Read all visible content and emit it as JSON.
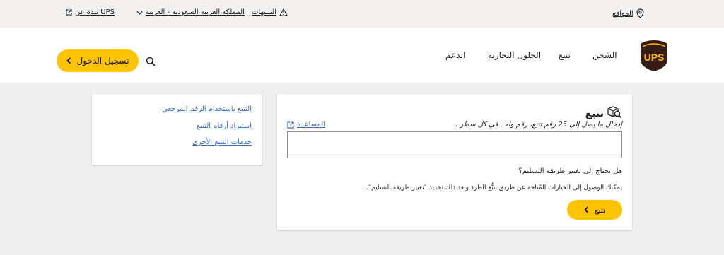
{
  "utility": {
    "about": "نبذة عن UPS",
    "country": "المملكة العربية السعودية - العربية",
    "alerts": "التنبيهات",
    "locations": "المواقع"
  },
  "nav": {
    "shipping": "الشحن",
    "track": "تتبع",
    "business": "الحلول التجارية",
    "support": "الدعم"
  },
  "login": {
    "label": "تسجيل الدخول"
  },
  "side_links": [
    "التتبع باستخدام الرقم المرجعي",
    "استيراد أرقام التتبع",
    "خدمات التتبع الأخرى"
  ],
  "track": {
    "title": "تتبع",
    "instructions": "إدخال ما يصل إلى 25 رقم تتبع، رقم واحد في كل سطر .",
    "help": "المساعدة",
    "input_value": "",
    "question": "هل تحتاج إلى تغيير طريقة التسليم؟",
    "info": "يمكنك الوصول إلى الخيارات المُتاحة عن طريق تتبُّع الطرد وبعد ذلك تحديد \"تغيير طريقة التسليم\".",
    "button": "تتبع"
  },
  "colors": {
    "accent": "#ffc400",
    "link": "#426da9",
    "brand_brown": "#351c15",
    "brand_gold": "#ffb500"
  },
  "icons": [
    "external-link-icon",
    "chevron-down-icon",
    "alert-triangle-icon",
    "location-pin-icon",
    "ups-logo",
    "search-icon",
    "chevron-left-icon",
    "track-package-icon"
  ]
}
